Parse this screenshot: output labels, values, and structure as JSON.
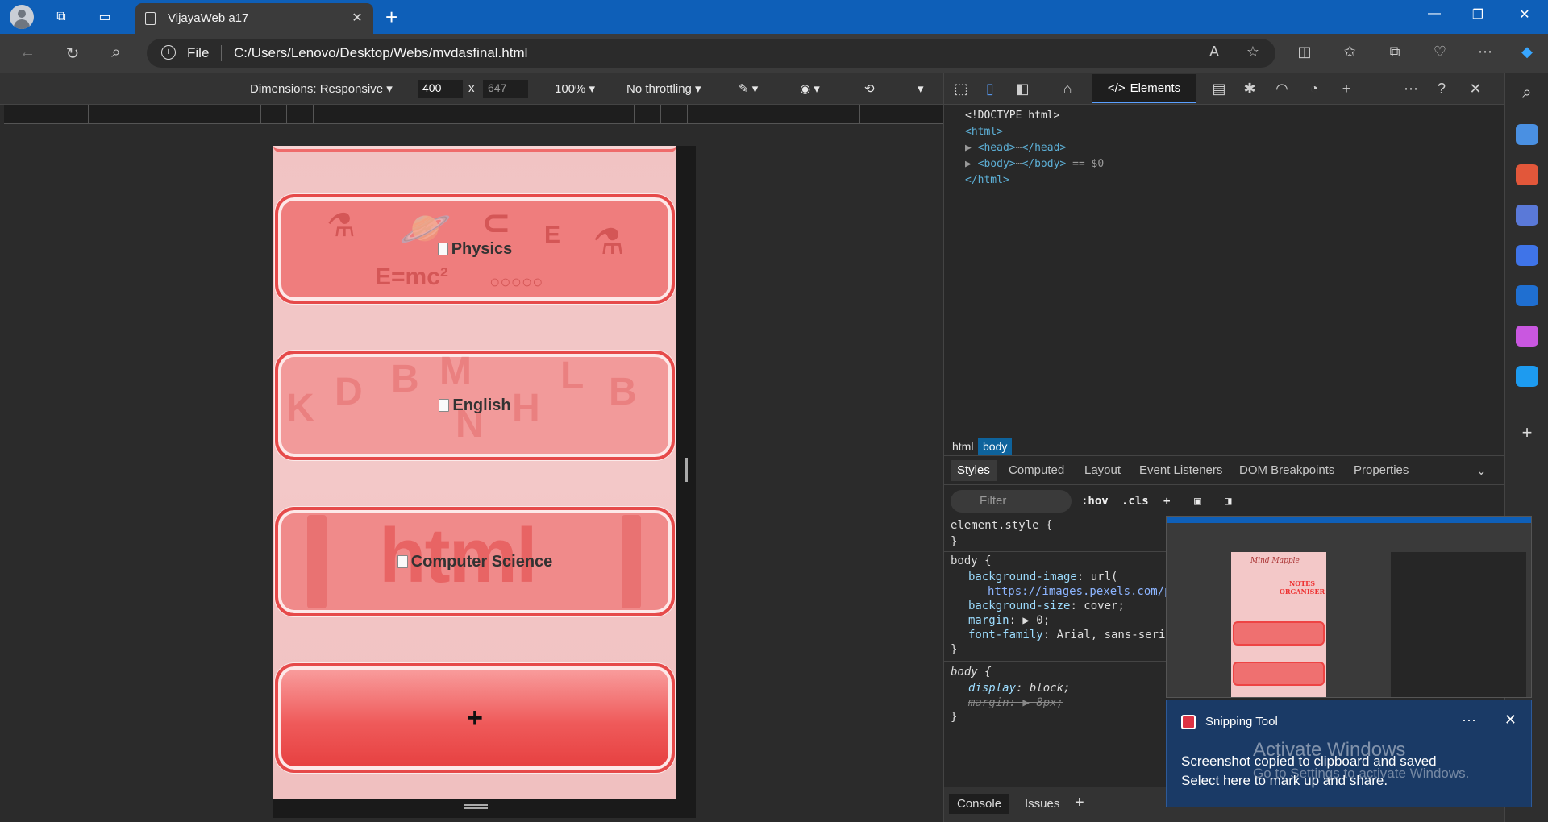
{
  "browser": {
    "tab_title": "VijayaWeb a17",
    "close_tab": "✕",
    "new_tab": "+",
    "file_label": "File",
    "url": "C:/Users/Lenovo/Desktop/Webs/mvdasfinal.html"
  },
  "device_toolbar": {
    "dimensions_label": "Dimensions: Responsive",
    "width_value": "400",
    "times": "x",
    "height_value": "647",
    "zoom": "100%",
    "throttling": "No throttling"
  },
  "page": {
    "cards": [
      {
        "label": "Physics"
      },
      {
        "label": "English"
      },
      {
        "label": "Computer Science"
      }
    ],
    "add_button": "+",
    "cs_decoration_text": "html"
  },
  "devtools": {
    "elements_tab": "Elements",
    "dom": {
      "doctype": "<!DOCTYPE html>",
      "html_open": "<html>",
      "head": "<head>",
      "head_close": "</head>",
      "body": "<body>",
      "body_close": "</body>",
      "body_eq": "== $0",
      "html_close": "</html>",
      "ellipsis": "⋯"
    },
    "breadcrumbs": [
      "html",
      "body"
    ],
    "panel_tabs": [
      "Styles",
      "Computed",
      "Layout",
      "Event Listeners",
      "DOM Breakpoints",
      "Properties"
    ],
    "filter_placeholder": "Filter",
    "hov": ":hov",
    "cls": ".cls",
    "styles": {
      "element_style": "element.style {",
      "close_brace": "}",
      "body_open": "body {",
      "bg_image_prop": "background-image",
      "bg_image_val": ": url(",
      "bg_image_url": "https://images.pexels.com/p",
      "bg_size_prop": "background-size",
      "bg_size_val": ": cover;",
      "margin_prop": "margin",
      "margin_val": ": ▶ 0;",
      "font_prop": "font-family",
      "font_val": ": Arial, sans-serif",
      "ua_display_prop": "display",
      "ua_display_val": ": block;",
      "ua_margin_prop": "margin",
      "ua_margin_val": ": ▶ 8px;"
    },
    "console_tabs": [
      "Console",
      "Issues"
    ]
  },
  "snipping_tool": {
    "app_name": "Snipping Tool",
    "message1": "Screenshot copied to clipboard and saved",
    "message2": "Select here to mark up and share.",
    "more": "···",
    "close": "✕",
    "preview_title": "Mind Mapple",
    "preview_notes": "NOTES ORGANISER"
  },
  "watermark": {
    "line1": "Activate Windows",
    "line2": "Go to Settings to activate Windows."
  },
  "colors": {
    "titlebar": "#0e5fb8",
    "card_border": "#e64a4a",
    "card_fill": "#ef7d7d",
    "page_bg": "#f3c8c8",
    "devtools_link": "#5db0d7"
  }
}
